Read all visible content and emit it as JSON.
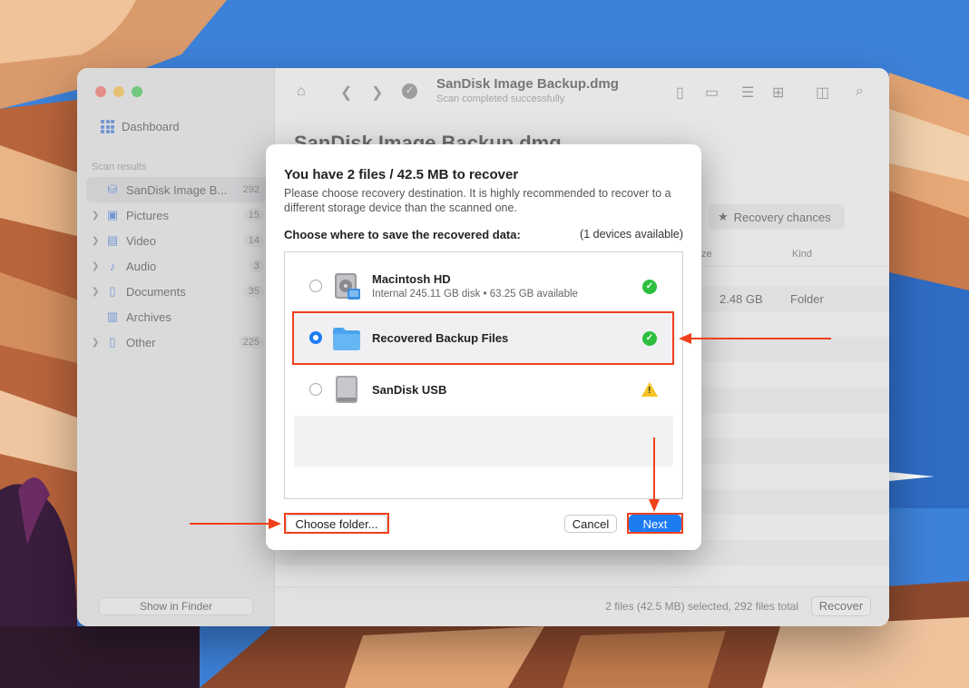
{
  "window": {
    "title": "SanDisk Image Backup.dmg",
    "subtitle": "Scan completed successfully",
    "content_title": "SanDisk Image Backup.dmg"
  },
  "sidebar": {
    "dashboard": "Dashboard",
    "section_title": "Scan results",
    "items": [
      {
        "label": "SanDisk Image B...",
        "count": "292"
      },
      {
        "label": "Pictures",
        "count": "15"
      },
      {
        "label": "Video",
        "count": "14"
      },
      {
        "label": "Audio",
        "count": "3"
      },
      {
        "label": "Documents",
        "count": "35"
      },
      {
        "label": "Archives",
        "count": ""
      },
      {
        "label": "Other",
        "count": "225"
      }
    ],
    "show_in_finder": "Show in Finder"
  },
  "main": {
    "recovery_chances": "Recovery chances",
    "col_size": "ze",
    "col_kind": "Kind",
    "row_size": "2.48 GB",
    "row_kind": "Folder",
    "status": "2 files (42.5 MB) selected, 292 files total",
    "recover": "Recover"
  },
  "modal": {
    "title": "You have 2 files / 42.5 MB to recover",
    "description": "Please choose recovery destination. It is highly recommended to recover to a different storage device than the scanned one.",
    "choose_label": "Choose where to save the recovered data:",
    "available": "(1 devices available)",
    "devices": [
      {
        "name": "Macintosh HD",
        "info": "Internal 245.11 GB disk • 63.25 GB available",
        "status": "ok",
        "selected": false
      },
      {
        "name": "Recovered Backup Files",
        "info": "",
        "status": "ok",
        "selected": true
      },
      {
        "name": "SanDisk USB",
        "info": "",
        "status": "warning",
        "selected": false
      }
    ],
    "choose_folder": "Choose folder...",
    "cancel": "Cancel",
    "next": "Next"
  },
  "colors": {
    "accent": "#1d7cf2",
    "highlight": "#f0401c",
    "ok": "#2dbe3e",
    "warning": "#f5c323"
  }
}
